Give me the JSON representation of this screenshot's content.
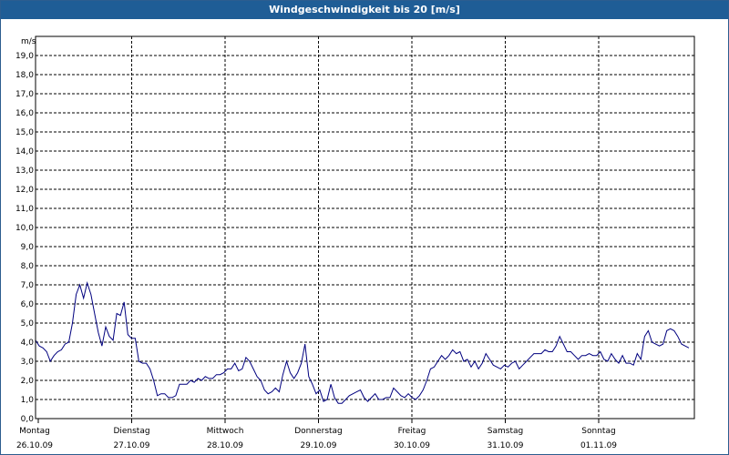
{
  "window": {
    "title": "Windgeschwindigkeit bis 20 [m/s]"
  },
  "chart_data": {
    "type": "line",
    "title": "Windgeschwindigkeit bis 20 [m/s]",
    "ylabel": "m/s",
    "ylim": [
      0,
      20
    ],
    "yticks": [
      "0,0",
      "1,0",
      "2,0",
      "3,0",
      "4,0",
      "5,0",
      "6,0",
      "7,0",
      "8,0",
      "9,0",
      "10,0",
      "11,0",
      "12,0",
      "13,0",
      "14,0",
      "15,0",
      "16,0",
      "17,0",
      "18,0",
      "19,0"
    ],
    "xlim_days": [
      0,
      7.0
    ],
    "days": [
      {
        "name": "Montag",
        "date": "26.10.09"
      },
      {
        "name": "Dienstag",
        "date": "27.10.09"
      },
      {
        "name": "Mittwoch",
        "date": "28.10.09"
      },
      {
        "name": "Donnerstag",
        "date": "29.10.09"
      },
      {
        "name": "Freitag",
        "date": "30.10.09"
      },
      {
        "name": "Samstag",
        "date": "31.10.09"
      },
      {
        "name": "Sonntag",
        "date": "01.11.09"
      }
    ],
    "grid": true,
    "color": "#00007f",
    "series": [
      {
        "values": [
          4.1,
          3.8,
          3.7,
          3.5,
          3.0,
          3.3,
          3.5,
          3.6,
          3.9,
          4.0,
          5.0,
          6.5,
          7.0,
          6.3,
          7.1,
          6.5,
          5.5,
          4.5,
          3.8,
          4.8,
          4.3,
          4.1,
          5.5,
          5.4,
          6.1,
          4.4,
          4.2,
          4.2,
          3.0,
          2.9,
          2.9,
          2.6,
          2.0,
          1.2,
          1.3,
          1.3,
          1.1,
          1.1,
          1.2,
          1.8,
          1.8,
          1.8,
          2.0,
          1.9,
          2.1,
          2.0,
          2.2,
          2.1,
          2.1,
          2.3,
          2.3,
          2.4,
          2.6,
          2.6,
          2.9,
          2.5,
          2.6,
          3.2,
          3.0,
          2.6,
          2.2,
          2.0,
          1.5,
          1.3,
          1.4,
          1.6,
          1.4,
          2.3,
          3.0,
          2.4,
          2.1,
          2.4,
          2.9,
          3.9,
          2.2,
          1.8,
          1.3,
          1.5,
          0.9,
          1.0,
          1.8,
          1.1,
          0.8,
          0.8,
          1.0,
          1.2,
          1.3,
          1.4,
          1.5,
          1.1,
          0.9,
          1.1,
          1.3,
          1.0,
          1.0,
          1.1,
          1.1,
          1.6,
          1.4,
          1.2,
          1.1,
          1.3,
          1.1,
          1.0,
          1.2,
          1.5,
          2.0,
          2.6,
          2.7,
          3.0,
          3.3,
          3.1,
          3.3,
          3.6,
          3.4,
          3.5,
          3.0,
          3.1,
          2.7,
          3.0,
          2.6,
          2.9,
          3.4,
          3.1,
          2.8,
          2.7,
          2.6,
          2.8,
          2.7,
          2.9,
          3.0,
          2.6,
          2.8,
          3.0,
          3.2,
          3.4,
          3.4,
          3.4,
          3.6,
          3.5,
          3.5,
          3.8,
          4.3,
          3.9,
          3.5,
          3.5,
          3.3,
          3.1,
          3.3,
          3.3,
          3.4,
          3.3,
          3.3,
          3.5,
          3.1,
          3.0,
          3.4,
          3.1,
          2.9,
          3.3,
          2.9,
          2.9,
          2.8,
          3.4,
          3.1,
          4.3,
          4.6,
          4.0,
          3.9,
          3.8,
          3.9,
          4.6,
          4.7,
          4.6,
          4.3,
          3.9,
          3.8,
          3.7
        ]
      }
    ]
  }
}
